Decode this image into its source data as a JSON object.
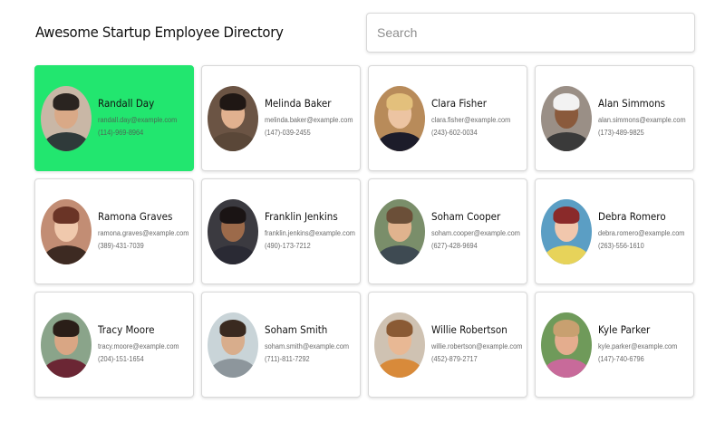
{
  "header": {
    "title": "Awesome Startup Employee Directory",
    "search_placeholder": "Search",
    "search_value": ""
  },
  "accent_color": "#22e66f",
  "selected_index": 0,
  "employees": [
    {
      "name": "Randall Day",
      "email": "randall.day@example.com",
      "phone": "(114)-969-8964",
      "photo": {
        "bg": "#c9b7a6",
        "skin": "#d9a987",
        "hair": "#2a2420",
        "shirt": "#2f3a3a"
      }
    },
    {
      "name": "Melinda Baker",
      "email": "melinda.baker@example.com",
      "phone": "(147)-039-2455",
      "photo": {
        "bg": "#6b5444",
        "skin": "#e1b18f",
        "hair": "#1f1714",
        "shirt": "#5a4738"
      }
    },
    {
      "name": "Clara Fisher",
      "email": "clara.fisher@example.com",
      "phone": "(243)-602-0034",
      "photo": {
        "bg": "#b88b5a",
        "skin": "#ecc4a2",
        "hair": "#e3c07c",
        "shirt": "#1c1c2a"
      }
    },
    {
      "name": "Alan Simmons",
      "email": "alan.simmons@example.com",
      "phone": "(173)-489-9825",
      "photo": {
        "bg": "#9a8f86",
        "skin": "#8a5a3c",
        "hair": "#f2f2f2",
        "shirt": "#3a3a3a"
      }
    },
    {
      "name": "Ramona Graves",
      "email": "ramona.graves@example.com",
      "phone": "(389)-431-7039",
      "photo": {
        "bg": "#c28d74",
        "skin": "#f0c9ad",
        "hair": "#6a3426",
        "shirt": "#3d2a22"
      }
    },
    {
      "name": "Franklin Jenkins",
      "email": "franklin.jenkins@example.com",
      "phone": "(490)-173-7212",
      "photo": {
        "bg": "#3b3a40",
        "skin": "#9c6a4a",
        "hair": "#1a1414",
        "shirt": "#2a2a34"
      }
    },
    {
      "name": "Soham Cooper",
      "email": "soham.cooper@example.com",
      "phone": "(627)-428-9694",
      "photo": {
        "bg": "#7a8e6a",
        "skin": "#e0b38e",
        "hair": "#6b4f38",
        "shirt": "#3e4a52"
      }
    },
    {
      "name": "Debra Romero",
      "email": "debra.romero@example.com",
      "phone": "(263)-556-1610",
      "photo": {
        "bg": "#5b9ec4",
        "skin": "#f1c7ad",
        "hair": "#8a2a2a",
        "shirt": "#e7d35a"
      }
    },
    {
      "name": "Tracy Moore",
      "email": "tracy.moore@example.com",
      "phone": "(204)-151-1654",
      "photo": {
        "bg": "#8aa48a",
        "skin": "#d9a684",
        "hair": "#2a1e18",
        "shirt": "#6b2634"
      }
    },
    {
      "name": "Soham Smith",
      "email": "soham.smith@example.com",
      "phone": "(711)-811-7292",
      "photo": {
        "bg": "#c9d4d8",
        "skin": "#d8ad8c",
        "hair": "#3a2a20",
        "shirt": "#8d969c"
      }
    },
    {
      "name": "Willie Robertson",
      "email": "willie.robertson@example.com",
      "phone": "(452)-879-2717",
      "photo": {
        "bg": "#cfc2b2",
        "skin": "#e8b894",
        "hair": "#8a5a34",
        "shirt": "#d88a3a"
      }
    },
    {
      "name": "Kyle Parker",
      "email": "kyle.parker@example.com",
      "phone": "(147)-740-6796",
      "photo": {
        "bg": "#6f9a5a",
        "skin": "#e4ad8e",
        "hair": "#c8a070",
        "shirt": "#c86a9a"
      }
    }
  ]
}
